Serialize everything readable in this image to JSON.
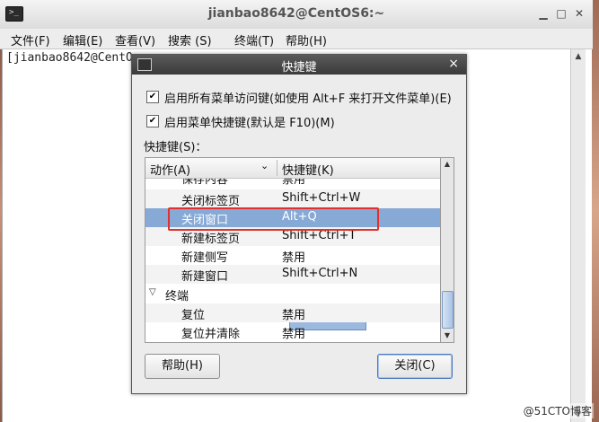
{
  "terminal": {
    "title": "jianbao8642@CentOS6:~",
    "icon": "terminal-icon",
    "menu": [
      {
        "label": "文件(F)"
      },
      {
        "label": "编辑(E)"
      },
      {
        "label": "查看(V)"
      },
      {
        "label": "搜索 (S)"
      },
      {
        "label": "终端(T)"
      },
      {
        "label": "帮助(H)"
      }
    ],
    "prompt": "[jianbao8642@CentO"
  },
  "dialog": {
    "title": "快捷键",
    "close_glyph": "×",
    "checkbox1": {
      "label": "启用所有菜单访问键(如使用 Alt+F 来打开文件菜单)(E)",
      "checked": true
    },
    "checkbox2": {
      "label": "启用菜单快捷键(默认是 F10)(M)",
      "checked": true
    },
    "section_label": "快捷键(S)：",
    "columns": {
      "action": "动作(A)",
      "shortcut": "快捷键(K)"
    },
    "rows": [
      {
        "action": "保存内容",
        "shortcut": "禁用"
      },
      {
        "action": "关闭标签页",
        "shortcut": "Shift+Ctrl+W"
      },
      {
        "action": "关闭窗口",
        "shortcut": "Alt+Q"
      },
      {
        "action": "新建标签页",
        "shortcut": "Shift+Ctrl+T"
      },
      {
        "action": "新建侧写",
        "shortcut": "禁用"
      },
      {
        "action": "新建窗口",
        "shortcut": "Shift+Ctrl+N"
      },
      {
        "action": "终端",
        "shortcut": ""
      },
      {
        "action": "复位",
        "shortcut": "禁用"
      },
      {
        "action": "复位并清除",
        "shortcut": "禁用"
      }
    ],
    "help_button": "帮助(H)",
    "close_button": "关闭(C)"
  },
  "watermark": "@51CTO博客",
  "colors": {
    "selection": "#86a9d6",
    "highlight_box": "#e0312e"
  }
}
